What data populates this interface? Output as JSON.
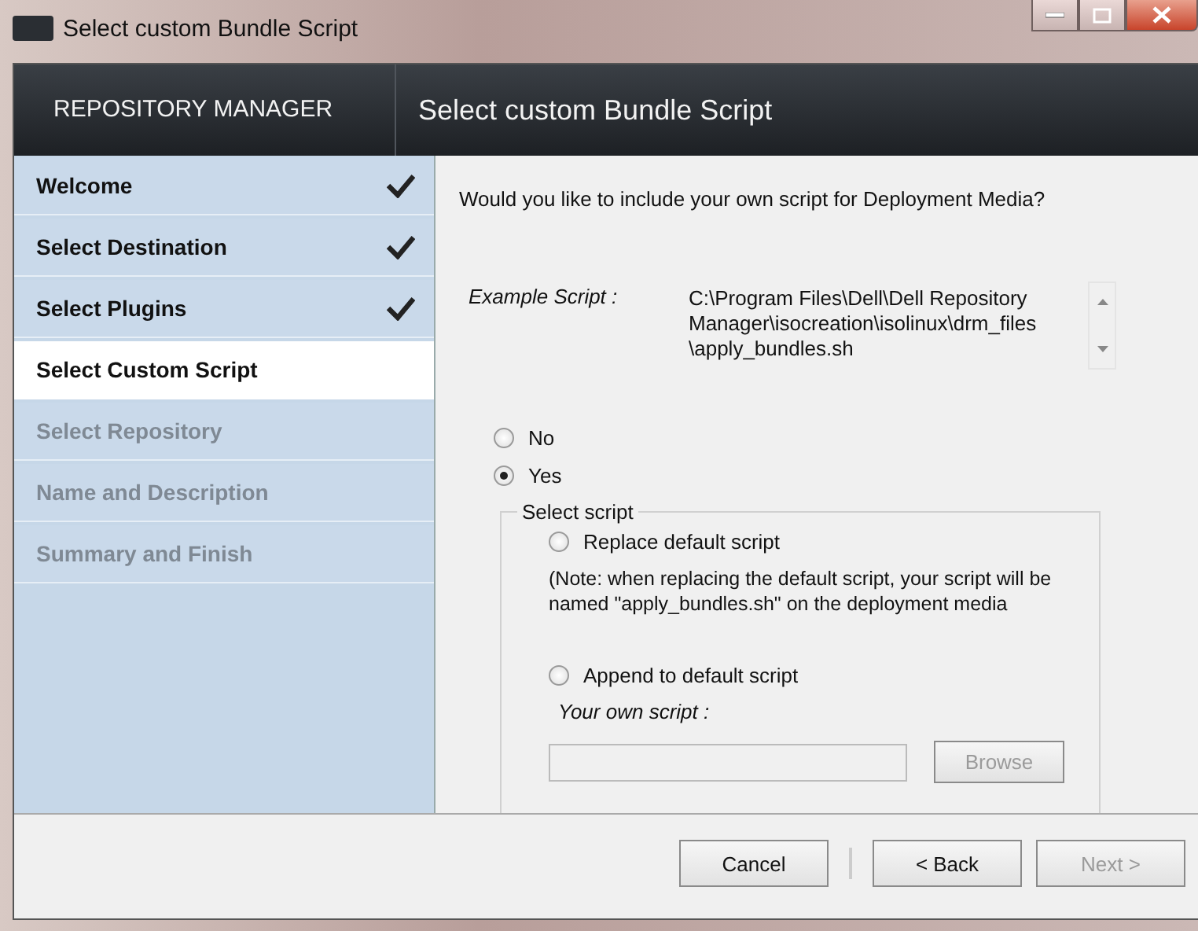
{
  "window": {
    "title": "Select custom Bundle Script"
  },
  "header": {
    "app_name": "REPOSITORY MANAGER",
    "page_title": "Select custom Bundle Script"
  },
  "steps": [
    {
      "label": "Welcome",
      "completed": true,
      "selected": false,
      "disabled": false
    },
    {
      "label": "Select Destination",
      "completed": true,
      "selected": false,
      "disabled": false
    },
    {
      "label": "Select Plugins",
      "completed": true,
      "selected": false,
      "disabled": false
    },
    {
      "label": "Select Custom Script",
      "completed": false,
      "selected": true,
      "disabled": false
    },
    {
      "label": "Select Repository",
      "completed": false,
      "selected": false,
      "disabled": true
    },
    {
      "label": "Name and Description",
      "completed": false,
      "selected": false,
      "disabled": true
    },
    {
      "label": "Summary and Finish",
      "completed": false,
      "selected": false,
      "disabled": true
    }
  ],
  "question": "Would you like to include your own script for Deployment Media?",
  "example_script": {
    "label": "Example Script :",
    "path": "C:\\Program Files\\Dell\\Dell Repository Manager\\isocreation\\isolinux\\drm_files \\apply_bundles.sh"
  },
  "include_options": [
    {
      "label": "No",
      "selected": false
    },
    {
      "label": "Yes",
      "selected": true
    }
  ],
  "select_script": {
    "legend": "Select script",
    "options": [
      {
        "label": "Replace default script",
        "selected": false
      },
      {
        "label": "Append to default script",
        "selected": false
      }
    ],
    "note": "(Note: when replacing the default script, your script will be named \"apply_bundles.sh\" on the deployment media",
    "own_script_label": "Your own script :",
    "browse": {
      "label": "Browse",
      "disabled": true
    }
  },
  "buttons": [
    {
      "label": "Cancel",
      "disabled": false
    },
    {
      "label": "< Back",
      "disabled": false
    },
    {
      "label": "Next >",
      "disabled": true
    }
  ]
}
